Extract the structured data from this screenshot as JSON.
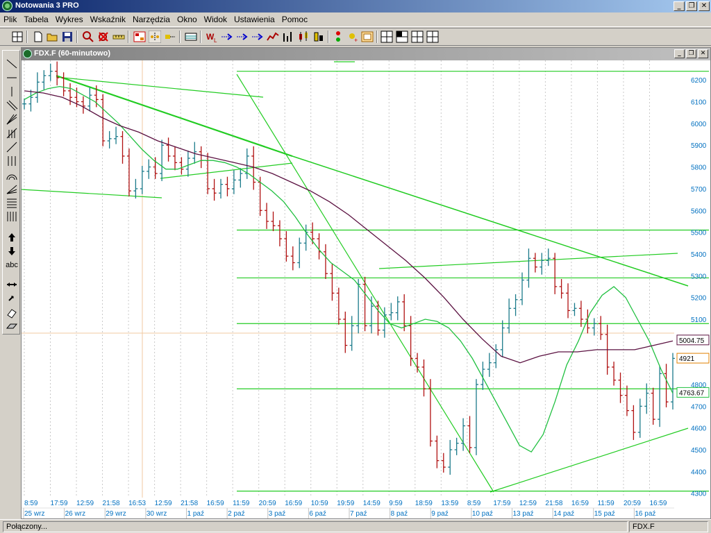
{
  "window": {
    "title": "Notowania 3 PRO",
    "minimize": "_",
    "restore": "❐",
    "close": "✕"
  },
  "menu": [
    "Plik",
    "Tabela",
    "Wykres",
    "Wskaźnik",
    "Narzędzia",
    "Okno",
    "Widok",
    "Ustawienia",
    "Pomoc"
  ],
  "toolbar_icons": [
    "grid-icon",
    "new-file-icon",
    "open-folder-icon",
    "save-icon",
    "zoom-icon",
    "delete-indicator-icon",
    "ruler-icon",
    "counter-icon",
    "pan-icon",
    "move-icon",
    "table-icon",
    "chart-w-icon",
    "arrow-right-1-icon",
    "arrow-right-2-icon",
    "arrow-right-3-icon",
    "line-chart-icon",
    "bar-chart-icon",
    "candlestick-icon",
    "ohlc-icon",
    "signal-icon",
    "marker-icon",
    "image-icon",
    "layout-1-icon",
    "layout-2-icon",
    "layout-3-icon",
    "layout-4-icon"
  ],
  "left_tools": [
    "line-tool-icon",
    "horizontal-line-tool-icon",
    "vertical-line-tool-icon",
    "parallel-channel-tool-icon",
    "fan-tool-icon",
    "gann-tool-icon",
    "trend-line-tool-icon",
    "vertical-lines-tool-icon",
    "arcs-tool-icon",
    "fan-lines-tool-icon",
    "fibonacci-tool-icon",
    "cycle-lines-tool-icon",
    "arrow-up-tool-icon",
    "arrow-down-tool-icon",
    "text-tool-icon",
    "horizontal-arrows-tool-icon",
    "resize-tool-icon",
    "eraser-tool-icon",
    "eraser-all-tool-icon"
  ],
  "left_tools_text": "abc",
  "chart_window": {
    "title": "FDX.F (60-minutowo)"
  },
  "price_labels": {
    "sma_long": "5004.75",
    "last": "4921",
    "sma_short": "4763.67"
  },
  "status": {
    "left": "Połączony...",
    "right": "FDX.F"
  },
  "colors": {
    "up_bar": "#1a7a8a",
    "down_bar": "#b01010",
    "ma_short": "#20c040",
    "ma_long": "#5a1040",
    "drawn_lines": "#22cc22",
    "axis_text": "#0070c0"
  },
  "chart_data": {
    "type": "ohlc",
    "symbol": "FDX.F",
    "interval": "60-minutowo",
    "ylim": [
      4280,
      6290
    ],
    "y_ticks": [
      6200,
      6100,
      6000,
      5900,
      5800,
      5700,
      5600,
      5500,
      5400,
      5300,
      5200,
      5100,
      4800,
      4700,
      4600,
      4500,
      4400,
      4300
    ],
    "x_time_labels": [
      "8:59",
      "17:59",
      "12:59",
      "21:58",
      "16:53",
      "12:59",
      "21:58",
      "16:59",
      "11:59",
      "20:59",
      "16:59",
      "10:59",
      "19:59",
      "14:59",
      "9:59",
      "18:59",
      "13:59",
      "8:59",
      "17:59",
      "12:59",
      "21:58",
      "16:59",
      "11:59",
      "20:59",
      "16:59"
    ],
    "x_date_labels": [
      "25 wrz",
      "26 wrz",
      "29 wrz",
      "30 wrz",
      "1 paź",
      "2 paź",
      "3 paź",
      "6 paź",
      "7 paź",
      "8 paź",
      "9 paź",
      "10 paź",
      "13 paź",
      "14 paź",
      "15 paź",
      "16 paź"
    ],
    "close_series": [
      6090,
      6120,
      6190,
      6220,
      6240,
      6210,
      6150,
      6120,
      6100,
      6080,
      6130,
      6110,
      5920,
      5930,
      5940,
      5850,
      5690,
      5700,
      5780,
      5800,
      5770,
      5900,
      5850,
      5820,
      5790,
      5840,
      5870,
      5830,
      5700,
      5680,
      5720,
      5700,
      5740,
      5770,
      5850,
      5730,
      5600,
      5550,
      5530,
      5470,
      5390,
      5360,
      5450,
      5500,
      5470,
      5410,
      5310,
      5220,
      5100,
      4980,
      5070,
      5260,
      5070,
      5160,
      5050,
      5120,
      5130,
      5180,
      5070,
      4920,
      4880,
      4780,
      4540,
      4450,
      4420,
      4500,
      4530,
      4610,
      4510,
      4800,
      4870,
      4900,
      4960,
      5060,
      5150,
      5190,
      5280,
      5380,
      5340,
      5370,
      5380,
      5250,
      5220,
      5140,
      5150,
      5100,
      5060,
      5080,
      5030,
      4880,
      4820,
      4750,
      4680,
      4580,
      4700,
      4760,
      4640,
      4850,
      4720,
      4920
    ],
    "moving_averages": [
      {
        "period": "short",
        "values": [
          6110,
          6140,
          6160,
          6170,
          6160,
          6130,
          6100,
          6050,
          6000,
          5940,
          5880,
          5830,
          5790,
          5790,
          5810,
          5830,
          5830,
          5820,
          5800,
          5770,
          5730,
          5690,
          5640,
          5570,
          5490,
          5420,
          5360,
          5320,
          5280,
          5210,
          5140,
          5080,
          5060,
          5080,
          5100,
          5090,
          5060,
          5000,
          4920,
          4820,
          4720,
          4620,
          4520,
          4490,
          4570,
          4720,
          4890,
          5000,
          5130,
          5210,
          5250,
          5200,
          5100,
          5000,
          4870,
          4760
        ]
      },
      {
        "period": "long",
        "values": [
          6150,
          6140,
          6120,
          6080,
          6030,
          5990,
          5960,
          5920,
          5890,
          5860,
          5840,
          5820,
          5800,
          5770,
          5730,
          5690,
          5640,
          5580,
          5510,
          5440,
          5370,
          5290,
          5200,
          5100,
          5010,
          4930,
          4900,
          4930,
          4950,
          4950,
          4960,
          4960,
          4960,
          4980,
          5000
        ]
      }
    ],
    "horizontal_levels": [
      6240,
      5510,
      5290,
      5080,
      4780,
      4310
    ],
    "grid": true
  }
}
